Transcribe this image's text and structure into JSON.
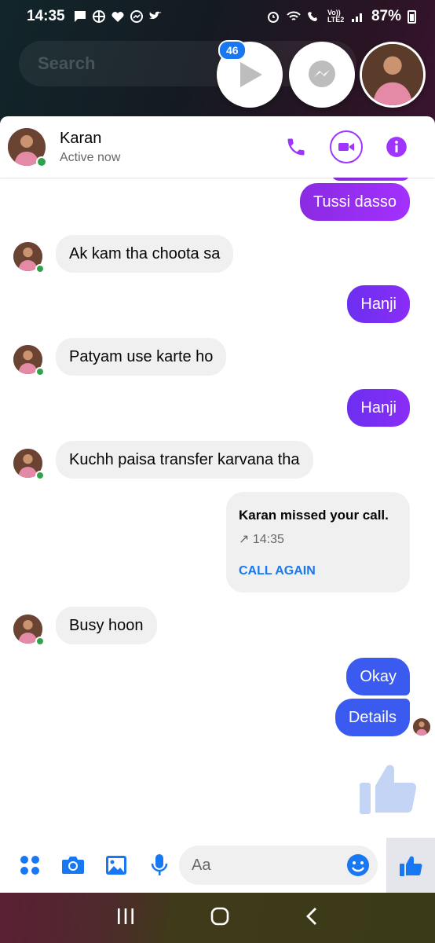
{
  "status_bar": {
    "time": "14:35",
    "battery": "87%",
    "network": "Vo)) LTE2"
  },
  "search": {
    "placeholder": "Search"
  },
  "chat_heads": {
    "badge_count": "46"
  },
  "header": {
    "name": "Karan",
    "status": "Active now"
  },
  "messages": [
    {
      "from": "me",
      "text": "Tussi dasso"
    },
    {
      "from": "them",
      "text": "Ak kam tha choota sa"
    },
    {
      "from": "me",
      "text": "Hanji"
    },
    {
      "from": "them",
      "text": "Patyam use karte ho"
    },
    {
      "from": "me",
      "text": "Hanji"
    },
    {
      "from": "them",
      "text": "Kuchh paisa transfer karvana tha"
    },
    {
      "from": "them",
      "text": "Busy hoon"
    },
    {
      "from": "me",
      "text": "Okay"
    },
    {
      "from": "me",
      "text": "Details"
    }
  ],
  "call_card": {
    "title": "Karan missed your call.",
    "time": "↗ 14:35",
    "action": "CALL AGAIN"
  },
  "composer": {
    "placeholder": "Aa"
  },
  "colors": {
    "messenger_purple": "#a033ff",
    "messenger_blue": "#1877f2",
    "bubble_blue": "#3b5bf0"
  }
}
